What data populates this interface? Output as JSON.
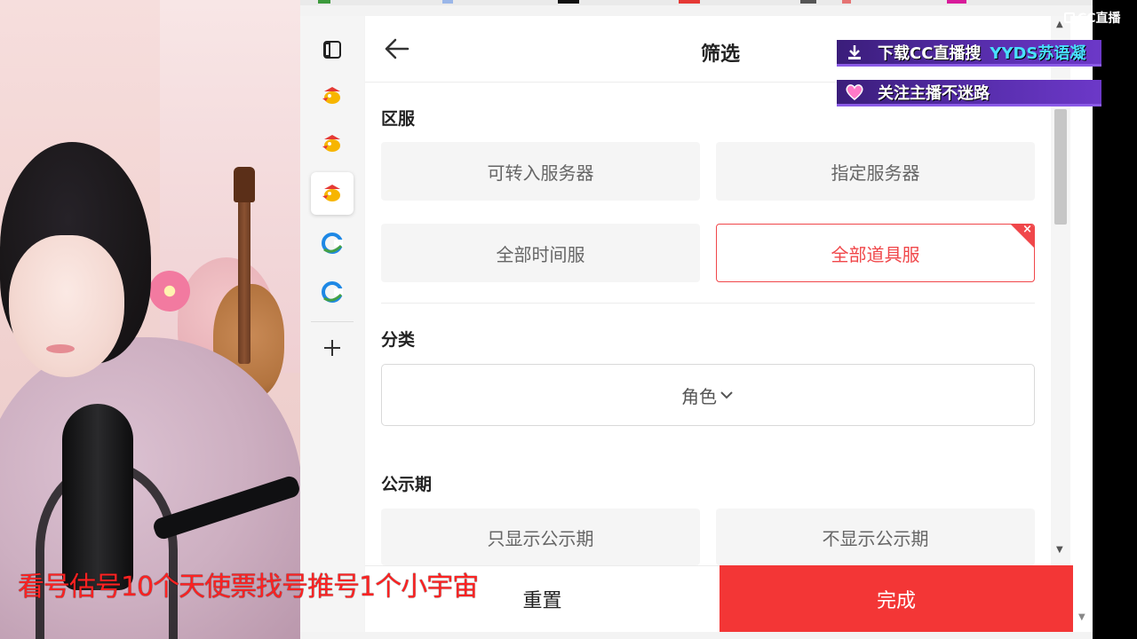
{
  "panel": {
    "title": "筛选"
  },
  "sections": {
    "server": {
      "title": "区服",
      "options": [
        "可转入服务器",
        "指定服务器",
        "全部时间服",
        "全部道具服"
      ],
      "selected_index": 3
    },
    "category": {
      "title": "分类",
      "dropdown_value": "角色",
      "dropdown_icon": "chevron-down-icon"
    },
    "publicity": {
      "title": "公示期",
      "options": [
        "只显示公示期",
        "不显示公示期"
      ]
    }
  },
  "footer": {
    "reset_label": "重置",
    "done_label": "完成"
  },
  "sidebar": {
    "items": [
      {
        "icon": "window-tab-icon"
      },
      {
        "icon": "game-app-icon"
      },
      {
        "icon": "game-app-icon"
      },
      {
        "icon": "game-app-icon",
        "active": true
      },
      {
        "icon": "browser-c-icon"
      },
      {
        "icon": "browser-c-icon"
      },
      {
        "icon": "plus-icon"
      }
    ]
  },
  "overlay": {
    "cc_logo": "CC直播",
    "banner_download": {
      "text": "下载CC直播搜",
      "highlight": "YYDS苏语凝",
      "icon": "download-icon"
    },
    "banner_follow": {
      "text": "关注主播不迷路",
      "icon": "heart-icon"
    },
    "ticker": "看号估号10个天使票找号推号1个小宇宙"
  },
  "colors": {
    "accent_red": "#f33636",
    "selected_border": "#f0474a",
    "banner_purple": "#5a2fb0",
    "banner_highlight": "#49e0ff"
  }
}
